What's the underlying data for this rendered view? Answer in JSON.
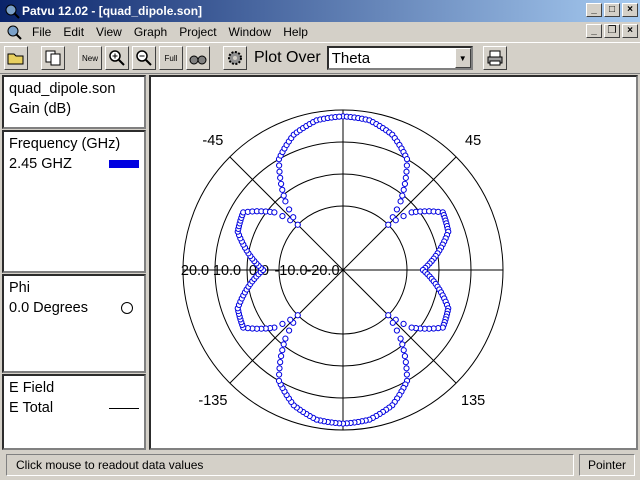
{
  "window": {
    "title": "Patvu 12.02 - [quad_dipole.son]",
    "min_glyph": "_",
    "max_glyph": "□",
    "close_glyph": "×",
    "restore_glyph": "❐"
  },
  "menu": {
    "items": [
      {
        "label": "File"
      },
      {
        "label": "Edit"
      },
      {
        "label": "View"
      },
      {
        "label": "Graph"
      },
      {
        "label": "Project"
      },
      {
        "label": "Window"
      },
      {
        "label": "Help"
      }
    ]
  },
  "toolbar": {
    "new_label": "New",
    "full_label": "Full",
    "plot_over_label": "Plot Over",
    "plot_over_value": "Theta"
  },
  "left_panel": {
    "file_name": "quad_dipole.son",
    "quantity": "Gain (dB)",
    "frequency_header": "Frequency (GHz)",
    "frequency_value": "2.45 GHZ",
    "frequency_color": "#0000e0",
    "phi_header": "Phi",
    "phi_value": "0.0 Degrees",
    "field_header": "E Field",
    "field_value": "E Total"
  },
  "chart_data": {
    "type": "polar-scatter",
    "angle_labels": [
      "-45",
      "45",
      "-135",
      "135"
    ],
    "radial_tick_labels": [
      "20.0",
      "10.0",
      "0.0",
      "-10.0",
      "-20.0"
    ],
    "radial_range_db": [
      -30,
      20
    ],
    "series": [
      {
        "color": "#0000e0",
        "marker": "circle",
        "theta_deg": [
          0,
          10,
          20,
          30,
          40,
          45,
          50,
          60,
          70,
          80,
          90,
          100,
          110,
          120,
          130,
          135,
          140,
          150,
          160,
          170,
          180,
          190,
          200,
          210,
          220,
          225,
          230,
          240,
          250,
          260,
          270,
          280,
          290,
          300,
          310,
          315,
          320,
          330,
          340,
          350
        ],
        "gain_db": [
          18,
          17.5,
          15,
          10,
          -2,
          -10,
          -2,
          6,
          5,
          0,
          -5,
          0,
          5,
          6,
          -2,
          -10,
          -2,
          10,
          15,
          17.5,
          18,
          17.5,
          15,
          10,
          -2,
          -10,
          -2,
          6,
          5,
          0,
          -5,
          0,
          5,
          6,
          -2,
          -10,
          -2,
          10,
          15,
          17.5
        ]
      }
    ]
  },
  "status": {
    "message": "Click mouse to readout data values",
    "mode": "Pointer"
  }
}
